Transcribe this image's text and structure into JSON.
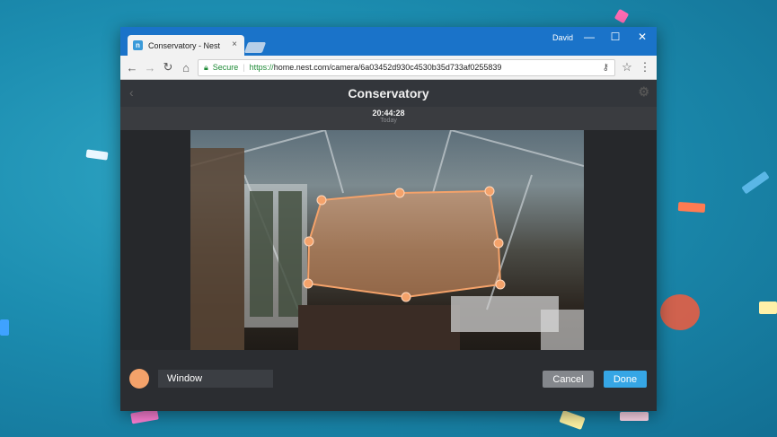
{
  "browser": {
    "tab_title": "Conservatory - Nest",
    "tab_close": "×",
    "favicon": "n",
    "user": "David",
    "minimize": "—",
    "maximize": "☐",
    "close": "✕",
    "secure_label": "Secure",
    "url_scheme": "https://",
    "url_rest": "home.nest.com/camera/6a03452d930c4530b35d733af0255839"
  },
  "app": {
    "title": "Conservatory",
    "time": "20:44:28",
    "day": "Today"
  },
  "zone": {
    "color": "#f4a26a",
    "name_value": "Window",
    "cancel_label": "Cancel",
    "done_label": "Done"
  },
  "icons": {
    "back": "back-arrow-icon",
    "forward": "forward-arrow-icon",
    "reload": "reload-icon",
    "home": "home-icon",
    "lock": "lock-icon",
    "key": "key-icon",
    "star": "star-icon",
    "menu": "menu-icon",
    "gear": "gear-icon",
    "chevron": "chevron-left-icon"
  },
  "colors": {
    "titlebar": "#1a73c9",
    "accent_done": "#36a6e5",
    "zone": "#f4a26a"
  }
}
